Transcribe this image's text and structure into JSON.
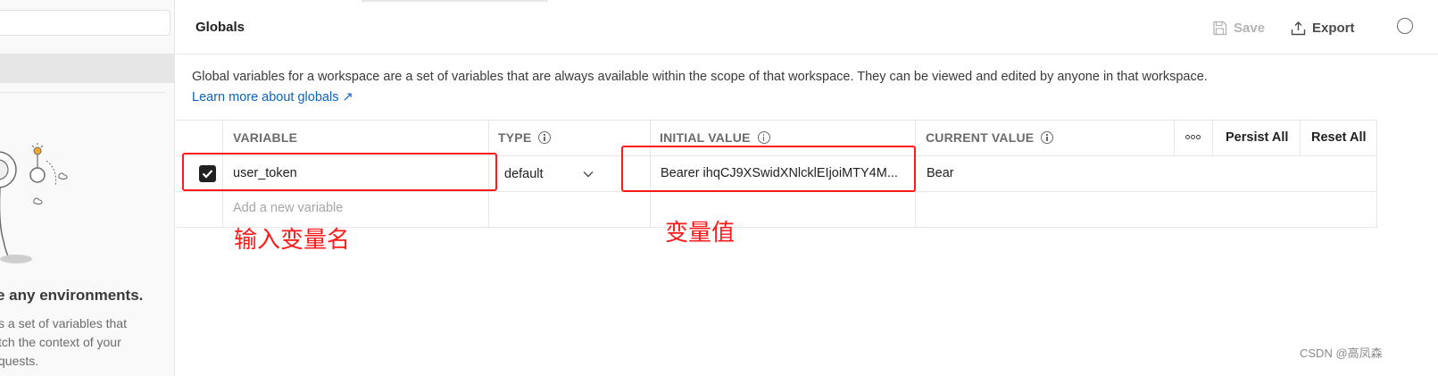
{
  "header": {
    "title": "Globals",
    "save_label": "Save",
    "export_label": "Export"
  },
  "description": {
    "text": "Global variables for a workspace are a set of variables that are always available within the scope of that workspace. They can be viewed and edited by anyone in that workspace.",
    "link_label": "Learn more about globals ↗"
  },
  "sidebar": {
    "empty_heading": "e any environments.",
    "empty_lines": [
      "s a set of variables that",
      "tch the context of your",
      "quests."
    ]
  },
  "table": {
    "columns": {
      "variable": "VARIABLE",
      "type": "TYPE",
      "initial_value": "INITIAL VALUE",
      "current_value": "CURRENT VALUE"
    },
    "persist_all_label": "Persist All",
    "reset_all_label": "Reset All",
    "rows": [
      {
        "checked": true,
        "variable": "user_token",
        "type": "default",
        "initial_value": "Bearer ihqCJ9XSwidXNlcklEIjoiMTY4M...",
        "current_value": "Bear"
      }
    ],
    "new_variable_placeholder": "Add a new variable"
  },
  "annotations": {
    "variable_name": "输入变量名",
    "variable_value": "变量值"
  },
  "watermark": "CSDN @高凤森",
  "colors": {
    "annotation_red": "#ff1a1a",
    "link_blue": "#0b64c4",
    "checkbox_dark": "#212121"
  },
  "icons": [
    "save-icon",
    "export-icon",
    "info-icon",
    "more-icon",
    "chevron-down-icon",
    "check-icon",
    "external-link-icon"
  ]
}
